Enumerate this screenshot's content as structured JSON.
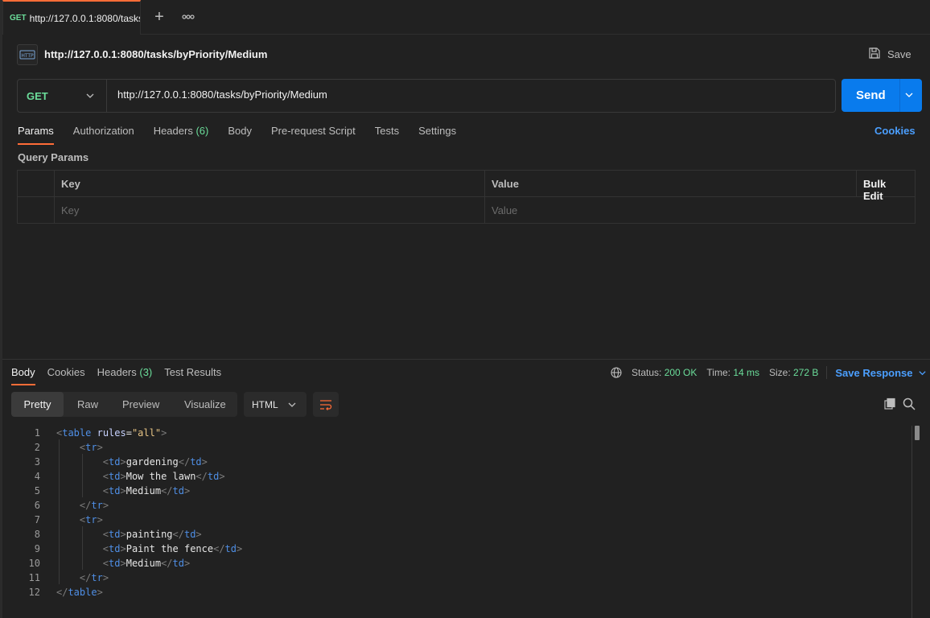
{
  "tab": {
    "method": "GET",
    "url": "http://127.0.0.1:8080/tasks/byPriority/Medium"
  },
  "header": {
    "title": "http://127.0.0.1:8080/tasks/byPriority/Medium",
    "save_label": "Save"
  },
  "request": {
    "method": "GET",
    "url": "http://127.0.0.1:8080/tasks/byPriority/Medium",
    "send_label": "Send"
  },
  "request_tabs": {
    "params": "Params",
    "authorization": "Authorization",
    "headers": "Headers",
    "headers_count": "(6)",
    "body": "Body",
    "prerequest": "Pre-request Script",
    "tests": "Tests",
    "settings": "Settings",
    "cookies": "Cookies"
  },
  "query_params": {
    "title": "Query Params",
    "col_key": "Key",
    "col_value": "Value",
    "bulk_edit": "Bulk Edit",
    "key_placeholder": "Key",
    "value_placeholder": "Value"
  },
  "response_tabs": {
    "body": "Body",
    "cookies": "Cookies",
    "headers": "Headers",
    "headers_count": "(3)",
    "test_results": "Test Results"
  },
  "response_status": {
    "status_label": "Status:",
    "status_value": "200 OK",
    "time_label": "Time:",
    "time_value": "14 ms",
    "size_label": "Size:",
    "size_value": "272 B",
    "save_response": "Save Response"
  },
  "view_modes": {
    "pretty": "Pretty",
    "raw": "Raw",
    "preview": "Preview",
    "visualize": "Visualize",
    "language": "HTML"
  },
  "code": {
    "line_numbers": [
      "1",
      "2",
      "3",
      "4",
      "5",
      "6",
      "7",
      "8",
      "9",
      "10",
      "11",
      "12"
    ],
    "lines": [
      "<table rules=\"all\">",
      "    <tr>",
      "        <td>gardening</td>",
      "        <td>Mow the lawn</td>",
      "        <td>Medium</td>",
      "    </tr>",
      "    <tr>",
      "        <td>painting</td>",
      "        <td>Paint the fence</td>",
      "        <td>Medium</td>",
      "    </tr>",
      "</table>"
    ]
  },
  "colors": {
    "accent": "#ff6c37",
    "send": "#097bed",
    "get": "#6bdd9a",
    "link": "#4b9fff",
    "bg": "#212121"
  }
}
